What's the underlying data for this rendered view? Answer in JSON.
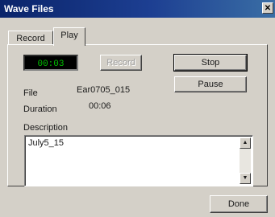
{
  "window": {
    "title": "Wave Files",
    "close_glyph": "✕"
  },
  "tabs": [
    {
      "label": "Record",
      "selected": false
    },
    {
      "label": "Play",
      "selected": true
    }
  ],
  "play": {
    "timer": "00:03",
    "buttons": {
      "record": "Record",
      "stop": "Stop",
      "pause": "Pause"
    },
    "file_label": "File",
    "file_value": "Ear0705_015",
    "duration_label": "Duration",
    "duration_value": "00:06",
    "description_label": "Description",
    "description_value": "July5_15"
  },
  "scroll": {
    "up_icon": "▲",
    "down_icon": "▼"
  },
  "footer": {
    "done_label": "Done"
  },
  "colors": {
    "titlebar": "#0a246a",
    "timer_bg": "#000000",
    "timer_fg": "#00c000",
    "face": "#d4d0c8"
  }
}
